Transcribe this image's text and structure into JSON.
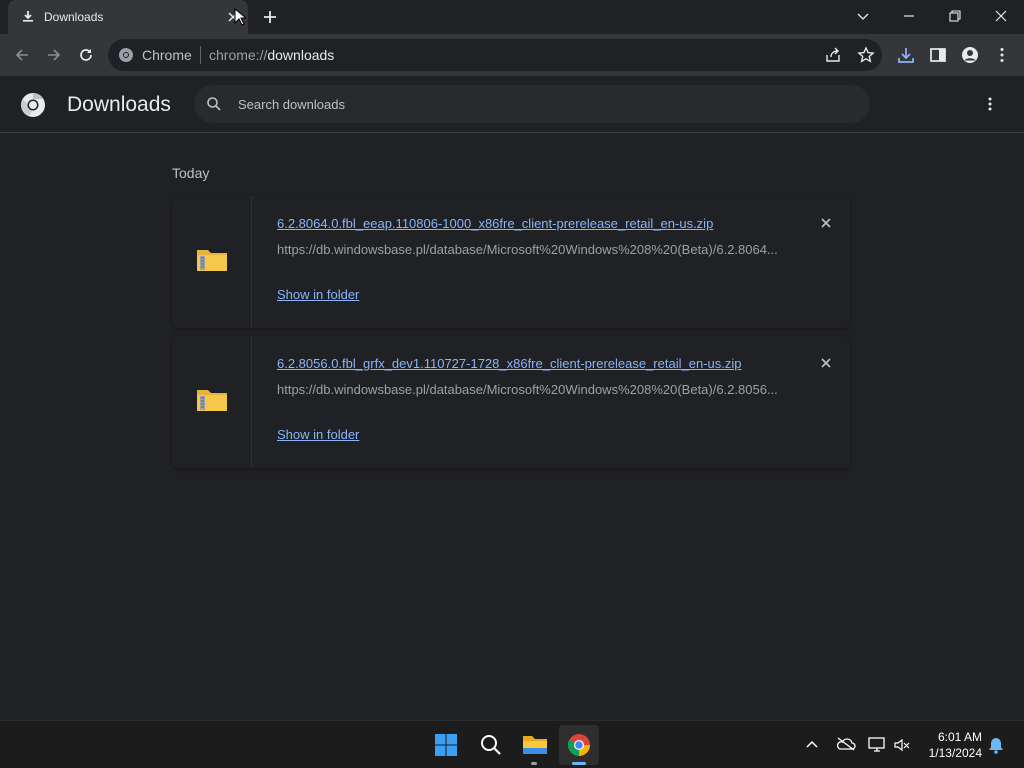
{
  "tab": {
    "title": "Downloads",
    "icon": "download-icon"
  },
  "omnibox": {
    "chip": "Chrome",
    "url_scheme": "chrome://",
    "url_host": "downloads"
  },
  "header": {
    "title": "Downloads",
    "search_placeholder": "Search downloads"
  },
  "main": {
    "section_label": "Today",
    "items": [
      {
        "filename": "6.2.8064.0.fbl_eeap.110806-1000_x86fre_client-prerelease_retail_en-us.zip",
        "url": "https://db.windowsbase.pl/database/Microsoft%20Windows%208%20(Beta)/6.2.8064...",
        "action": "Show in folder",
        "icon": "zip-folder-icon"
      },
      {
        "filename": "6.2.8056.0.fbl_grfx_dev1.110727-1728_x86fre_client-prerelease_retail_en-us.zip",
        "url": "https://db.windowsbase.pl/database/Microsoft%20Windows%208%20(Beta)/6.2.8056...",
        "action": "Show in folder",
        "icon": "zip-folder-icon"
      }
    ]
  },
  "taskbar": {
    "time": "6:01 AM",
    "date": "1/13/2024"
  },
  "colors": {
    "accent_link": "#8ab4f8",
    "background": "#202124",
    "toolbar": "#35363a"
  }
}
